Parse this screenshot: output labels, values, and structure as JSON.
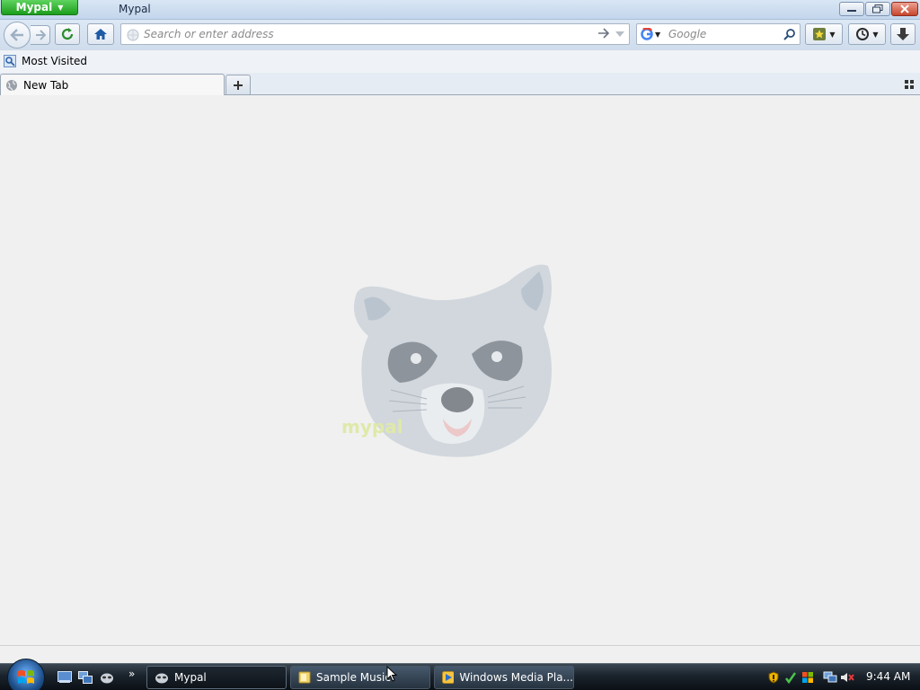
{
  "window": {
    "app_button_label": "Mypal",
    "title": "Mypal"
  },
  "navbar": {
    "url_placeholder": "Search or enter address",
    "search_placeholder": "Google"
  },
  "bookmarks": {
    "items": [
      {
        "label": "Most Visited"
      }
    ]
  },
  "tabs": [
    {
      "label": "New Tab"
    }
  ],
  "content": {
    "logo_text": "mypal"
  },
  "taskbar": {
    "tasks": [
      {
        "label": "Mypal"
      },
      {
        "label": "Sample Music"
      },
      {
        "label": "Windows Media Pla..."
      }
    ],
    "clock": "9:44 AM"
  },
  "colors": {
    "app_button": "#1c9e1c",
    "titlebar": "#c3d6ec",
    "taskbar": "#1a232c",
    "content_bg": "#f0f0f0"
  },
  "icons": [
    "back-arrow",
    "forward-arrow",
    "reload",
    "home",
    "globe",
    "go-arrow",
    "dropdown",
    "google",
    "search",
    "bookmarks-star",
    "history-clock",
    "download",
    "plus",
    "tab-list-grid",
    "windows-orb",
    "show-desktop",
    "switch-windows",
    "raccoon",
    "shield",
    "network",
    "volume-muted"
  ]
}
